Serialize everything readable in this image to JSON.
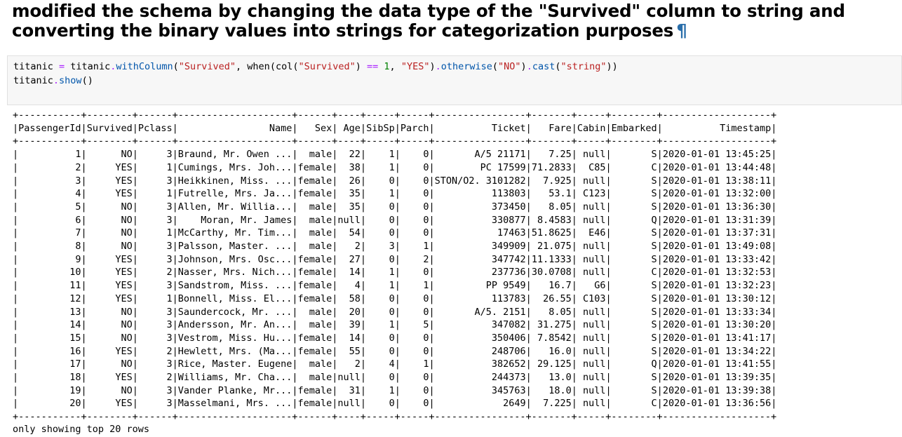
{
  "markdown": {
    "heading": "modified the schema by changing the data type of the \"Survived\" column to string and converting the binary values into strings for categorization purposes",
    "anchor": "¶"
  },
  "code": {
    "line1": [
      {
        "t": "titanic ",
        "c": ""
      },
      {
        "t": "=",
        "c": "op"
      },
      {
        "t": " titanic",
        "c": ""
      },
      {
        "t": ".",
        "c": "op"
      },
      {
        "t": "withColumn",
        "c": "attr"
      },
      {
        "t": "(",
        "c": ""
      },
      {
        "t": "\"Survived\"",
        "c": "str"
      },
      {
        "t": ", when(col(",
        "c": ""
      },
      {
        "t": "\"Survived\"",
        "c": "str"
      },
      {
        "t": ") ",
        "c": ""
      },
      {
        "t": "==",
        "c": "op"
      },
      {
        "t": " ",
        "c": ""
      },
      {
        "t": "1",
        "c": "num"
      },
      {
        "t": ", ",
        "c": ""
      },
      {
        "t": "\"YES\"",
        "c": "str"
      },
      {
        "t": ")",
        "c": ""
      },
      {
        "t": ".",
        "c": "op"
      },
      {
        "t": "otherwise",
        "c": "attr"
      },
      {
        "t": "(",
        "c": ""
      },
      {
        "t": "\"NO\"",
        "c": "str"
      },
      {
        "t": ")",
        "c": ""
      },
      {
        "t": ".",
        "c": "op"
      },
      {
        "t": "cast",
        "c": "attr"
      },
      {
        "t": "(",
        "c": ""
      },
      {
        "t": "\"string\"",
        "c": "str"
      },
      {
        "t": "))",
        "c": ""
      }
    ],
    "line2": [
      {
        "t": "titanic",
        "c": ""
      },
      {
        "t": ".",
        "c": "op"
      },
      {
        "t": "show",
        "c": "attr"
      },
      {
        "t": "()",
        "c": ""
      }
    ]
  },
  "table": {
    "widths": [
      11,
      8,
      6,
      20,
      6,
      4,
      5,
      5,
      16,
      7,
      5,
      8,
      19
    ],
    "columns": [
      "PassengerId",
      "Survived",
      "Pclass",
      "Name",
      "Sex",
      "Age",
      "SibSp",
      "Parch",
      "Ticket",
      "Fare",
      "Cabin",
      "Embarked",
      "Timestamp"
    ],
    "rows": [
      [
        "1",
        "NO",
        "3",
        "Braund, Mr. Owen ...",
        "male",
        "22",
        "1",
        "0",
        "A/5 21171",
        "7.25",
        "null",
        "S",
        "2020-01-01 13:45:25"
      ],
      [
        "2",
        "YES",
        "1",
        "Cumings, Mrs. Joh...",
        "female",
        "38",
        "1",
        "0",
        "PC 17599",
        "71.2833",
        "C85",
        "C",
        "2020-01-01 13:44:48"
      ],
      [
        "3",
        "YES",
        "3",
        "Heikkinen, Miss. ...",
        "female",
        "26",
        "0",
        "0",
        "STON/O2. 3101282",
        "7.925",
        "null",
        "S",
        "2020-01-01 13:38:11"
      ],
      [
        "4",
        "YES",
        "1",
        "Futrelle, Mrs. Ja...",
        "female",
        "35",
        "1",
        "0",
        "113803",
        "53.1",
        "C123",
        "S",
        "2020-01-01 13:32:00"
      ],
      [
        "5",
        "NO",
        "3",
        "Allen, Mr. Willia...",
        "male",
        "35",
        "0",
        "0",
        "373450",
        "8.05",
        "null",
        "S",
        "2020-01-01 13:36:30"
      ],
      [
        "6",
        "NO",
        "3",
        "Moran, Mr. James",
        "male",
        "null",
        "0",
        "0",
        "330877",
        "8.4583",
        "null",
        "Q",
        "2020-01-01 13:31:39"
      ],
      [
        "7",
        "NO",
        "1",
        "McCarthy, Mr. Tim...",
        "male",
        "54",
        "0",
        "0",
        "17463",
        "51.8625",
        "E46",
        "S",
        "2020-01-01 13:37:31"
      ],
      [
        "8",
        "NO",
        "3",
        "Palsson, Master. ...",
        "male",
        "2",
        "3",
        "1",
        "349909",
        "21.075",
        "null",
        "S",
        "2020-01-01 13:49:08"
      ],
      [
        "9",
        "YES",
        "3",
        "Johnson, Mrs. Osc...",
        "female",
        "27",
        "0",
        "2",
        "347742",
        "11.1333",
        "null",
        "S",
        "2020-01-01 13:33:42"
      ],
      [
        "10",
        "YES",
        "2",
        "Nasser, Mrs. Nich...",
        "female",
        "14",
        "1",
        "0",
        "237736",
        "30.0708",
        "null",
        "C",
        "2020-01-01 13:32:53"
      ],
      [
        "11",
        "YES",
        "3",
        "Sandstrom, Miss. ...",
        "female",
        "4",
        "1",
        "1",
        "PP 9549",
        "16.7",
        "G6",
        "S",
        "2020-01-01 13:32:23"
      ],
      [
        "12",
        "YES",
        "1",
        "Bonnell, Miss. El...",
        "female",
        "58",
        "0",
        "0",
        "113783",
        "26.55",
        "C103",
        "S",
        "2020-01-01 13:30:12"
      ],
      [
        "13",
        "NO",
        "3",
        "Saundercock, Mr. ...",
        "male",
        "20",
        "0",
        "0",
        "A/5. 2151",
        "8.05",
        "null",
        "S",
        "2020-01-01 13:33:34"
      ],
      [
        "14",
        "NO",
        "3",
        "Andersson, Mr. An...",
        "male",
        "39",
        "1",
        "5",
        "347082",
        "31.275",
        "null",
        "S",
        "2020-01-01 13:30:20"
      ],
      [
        "15",
        "NO",
        "3",
        "Vestrom, Miss. Hu...",
        "female",
        "14",
        "0",
        "0",
        "350406",
        "7.8542",
        "null",
        "S",
        "2020-01-01 13:41:17"
      ],
      [
        "16",
        "YES",
        "2",
        "Hewlett, Mrs. (Ma...",
        "female",
        "55",
        "0",
        "0",
        "248706",
        "16.0",
        "null",
        "S",
        "2020-01-01 13:34:22"
      ],
      [
        "17",
        "NO",
        "3",
        "Rice, Master. Eugene",
        "male",
        "2",
        "4",
        "1",
        "382652",
        "29.125",
        "null",
        "Q",
        "2020-01-01 13:41:55"
      ],
      [
        "18",
        "YES",
        "2",
        "Williams, Mr. Cha...",
        "male",
        "null",
        "0",
        "0",
        "244373",
        "13.0",
        "null",
        "S",
        "2020-01-01 13:39:35"
      ],
      [
        "19",
        "NO",
        "3",
        "Vander Planke, Mr...",
        "female",
        "31",
        "1",
        "0",
        "345763",
        "18.0",
        "null",
        "S",
        "2020-01-01 13:39:38"
      ],
      [
        "20",
        "YES",
        "3",
        "Masselmani, Mrs. ...",
        "female",
        "null",
        "0",
        "0",
        "2649",
        "7.225",
        "null",
        "C",
        "2020-01-01 13:36:56"
      ]
    ]
  },
  "footer": "only showing top 20 rows",
  "colors": {
    "op": "#aa22ff",
    "attr": "#0055aa",
    "str": "#ba2121",
    "num": "#008000",
    "anchor": "#296eaa",
    "cell_bg": "#f7f7f7"
  }
}
